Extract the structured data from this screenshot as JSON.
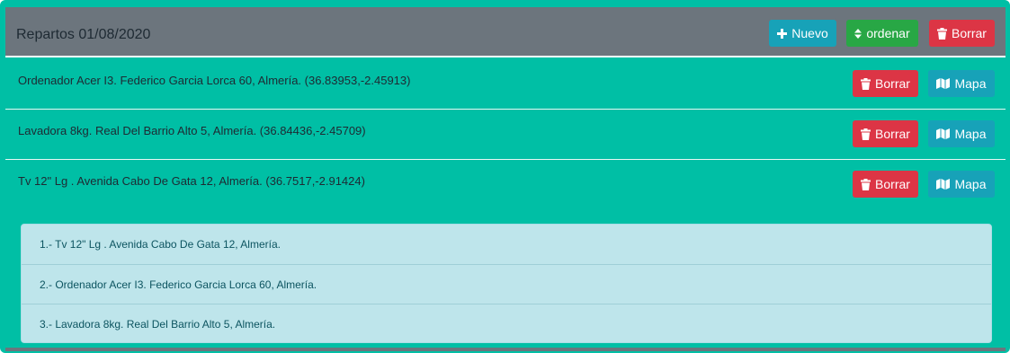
{
  "header": {
    "title": "Repartos 01/08/2020",
    "new_label": "Nuevo",
    "sort_label": "ordenar",
    "delete_label": "Borrar"
  },
  "deliveries": [
    {
      "text": "Ordenador Acer I3. Federico Garcia Lorca 60, Almería. (36.83953,-2.45913)",
      "delete_label": "Borrar",
      "map_label": "Mapa"
    },
    {
      "text": "Lavadora 8kg. Real Del Barrio Alto 5, Almería. (36.84436,-2.45709)",
      "delete_label": "Borrar",
      "map_label": "Mapa"
    },
    {
      "text": "Tv 12\" Lg . Avenida Cabo De Gata 12, Almería. (36.7517,-2.91424)",
      "delete_label": "Borrar",
      "map_label": "Mapa"
    }
  ],
  "ordered_list": [
    "1.- Tv 12\" Lg . Avenida Cabo De Gata 12, Almería.",
    "2.- Ordenador Acer I3. Federico Garcia Lorca 60, Almería.",
    "3.- Lavadora 8kg. Real Del Barrio Alto 5, Almería."
  ],
  "colors": {
    "card_bg": "#00bfa5",
    "header_bg": "#6c757d",
    "info": "#17a2b8",
    "success": "#28a745",
    "danger": "#dc3545",
    "list_bg": "#bee5eb",
    "list_text": "#0c5460"
  },
  "icons": {
    "new": "plus-icon",
    "sort": "sort-icon",
    "delete": "trash-icon",
    "map": "map-icon"
  }
}
